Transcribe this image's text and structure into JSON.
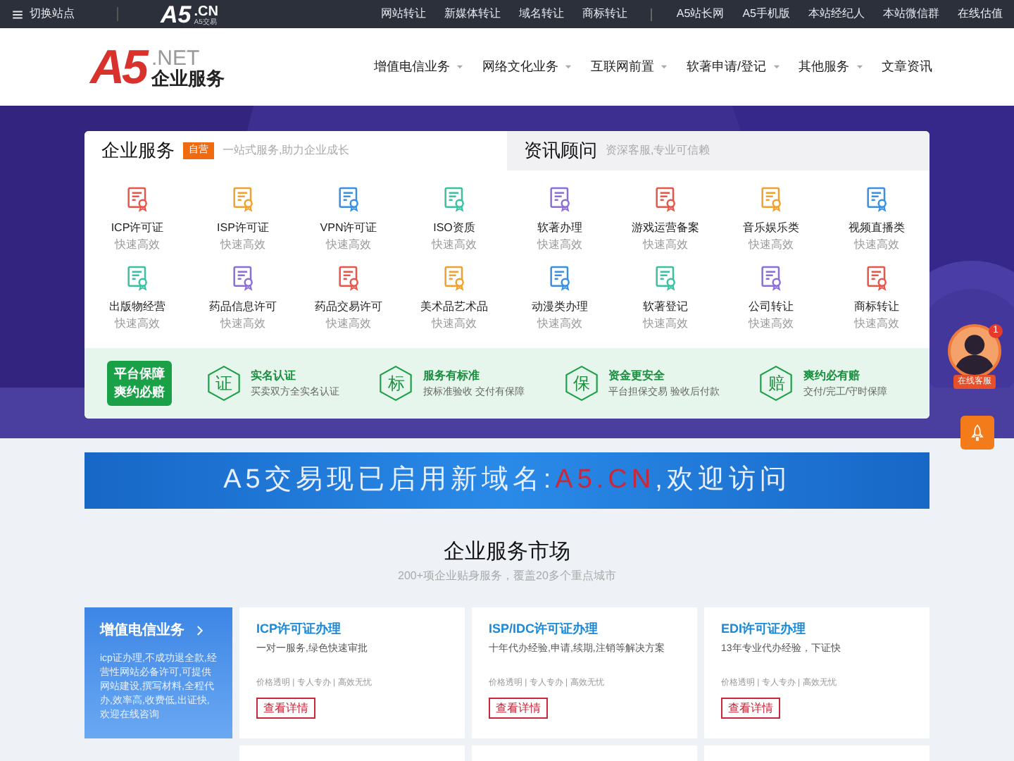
{
  "top_bar": {
    "site_switch": "切换站点",
    "logo": {
      "mark": "A5",
      "suffix": ".CN",
      "sub": "A5交易"
    },
    "links_left": [
      "网站转让",
      "新媒体转让",
      "域名转让",
      "商标转让"
    ],
    "links_right": [
      "A5站长网",
      "A5手机版",
      "本站经纪人",
      "本站微信群",
      "在线估值"
    ]
  },
  "header": {
    "logo": {
      "mark": "A5",
      "suffix": ".NET",
      "name": "企业服务"
    },
    "nav": [
      {
        "label": "增值电信业务",
        "has_menu": true
      },
      {
        "label": "网络文化业务",
        "has_menu": true
      },
      {
        "label": "互联网前置",
        "has_menu": true
      },
      {
        "label": "软著申请/登记",
        "has_menu": true
      },
      {
        "label": "其他服务",
        "has_menu": true
      },
      {
        "label": "文章资讯",
        "has_menu": false
      }
    ]
  },
  "panel": {
    "tabs": [
      {
        "title": "企业服务",
        "badge": "自营",
        "subtitle": "一站式服务,助力企业成长",
        "selected": true
      },
      {
        "title": "资讯顾问",
        "subtitle": "资深客服,专业可信赖",
        "selected": false
      }
    ],
    "services": [
      {
        "name": "ICP许可证",
        "note": "快速高效",
        "color": "#e5564b"
      },
      {
        "name": "ISP许可证",
        "note": "快速高效",
        "color": "#f0a030"
      },
      {
        "name": "VPN许可证",
        "note": "快速高效",
        "color": "#3b8fe0"
      },
      {
        "name": "ISO资质",
        "note": "快速高效",
        "color": "#3cc0a0"
      },
      {
        "name": "软著办理",
        "note": "快速高效",
        "color": "#8a6fd8"
      },
      {
        "name": "游戏运营备案",
        "note": "快速高效",
        "color": "#e5564b"
      },
      {
        "name": "音乐娱乐类",
        "note": "快速高效",
        "color": "#f0a030"
      },
      {
        "name": "视频直播类",
        "note": "快速高效",
        "color": "#3b8fe0"
      },
      {
        "name": "出版物经营",
        "note": "快速高效",
        "color": "#3cc0a0"
      },
      {
        "name": "药品信息许可",
        "note": "快速高效",
        "color": "#8a6fd8"
      },
      {
        "name": "药品交易许可",
        "note": "快速高效",
        "color": "#e5564b"
      },
      {
        "name": "美术品艺术品",
        "note": "快速高效",
        "color": "#f0a030"
      },
      {
        "name": "动漫类办理",
        "note": "快速高效",
        "color": "#3b8fe0"
      },
      {
        "name": "软著登记",
        "note": "快速高效",
        "color": "#3cc0a0"
      },
      {
        "name": "公司转让",
        "note": "快速高效",
        "color": "#8a6fd8"
      },
      {
        "name": "商标转让",
        "note": "快速高效",
        "color": "#e5564b"
      }
    ],
    "guarantee": {
      "label": [
        "平台保障",
        "爽约必赔"
      ],
      "items": [
        {
          "glyph": "证",
          "title": "实名认证",
          "desc": "买卖双方全实名认证"
        },
        {
          "glyph": "标",
          "title": "服务有标准",
          "desc": "按标准验收 交付有保障"
        },
        {
          "glyph": "保",
          "title": "资金更安全",
          "desc": "平台担保交易 验收后付款"
        },
        {
          "glyph": "赔",
          "title": "爽约必有赔",
          "desc": "交付/完工/守时保障"
        }
      ]
    }
  },
  "float": {
    "chat": {
      "badge": "1",
      "label": "在线客服"
    }
  },
  "banner": {
    "parts": [
      {
        "text": "A5交易现已启用新域名:",
        "highlight": false
      },
      {
        "text": "A5.CN",
        "highlight": true
      },
      {
        "text": ",欢迎访问",
        "highlight": false
      }
    ]
  },
  "market": {
    "title": "企业服务市场",
    "subtitle": "200+项企业贴身服务，覆盖20多个重点城市",
    "category": {
      "title": "增值电信业务",
      "desc": "icp证办理,不成功退全款,经营性网站必备许可,可提供网站建设,撰写材料,全程代办,效率高,收费低,出证快,欢迎在线咨询"
    },
    "cards": [
      {
        "title": "ICP许可证办理",
        "desc": "一对一服务,绿色快速审批",
        "tags": "价格透明 | 专人专办 | 高效无忧",
        "button": "查看详情"
      },
      {
        "title": "ISP/IDC许可证办理",
        "desc": "十年代办经验,申请,续期,注销等解决方案",
        "tags": "价格透明 | 专人专办 | 高效无忧",
        "button": "查看详情"
      },
      {
        "title": "EDI许可证办理",
        "desc": "13年专业代办经验，下证快",
        "tags": "价格透明 | 专人专办 | 高效无忧",
        "button": "查看详情"
      }
    ]
  }
}
